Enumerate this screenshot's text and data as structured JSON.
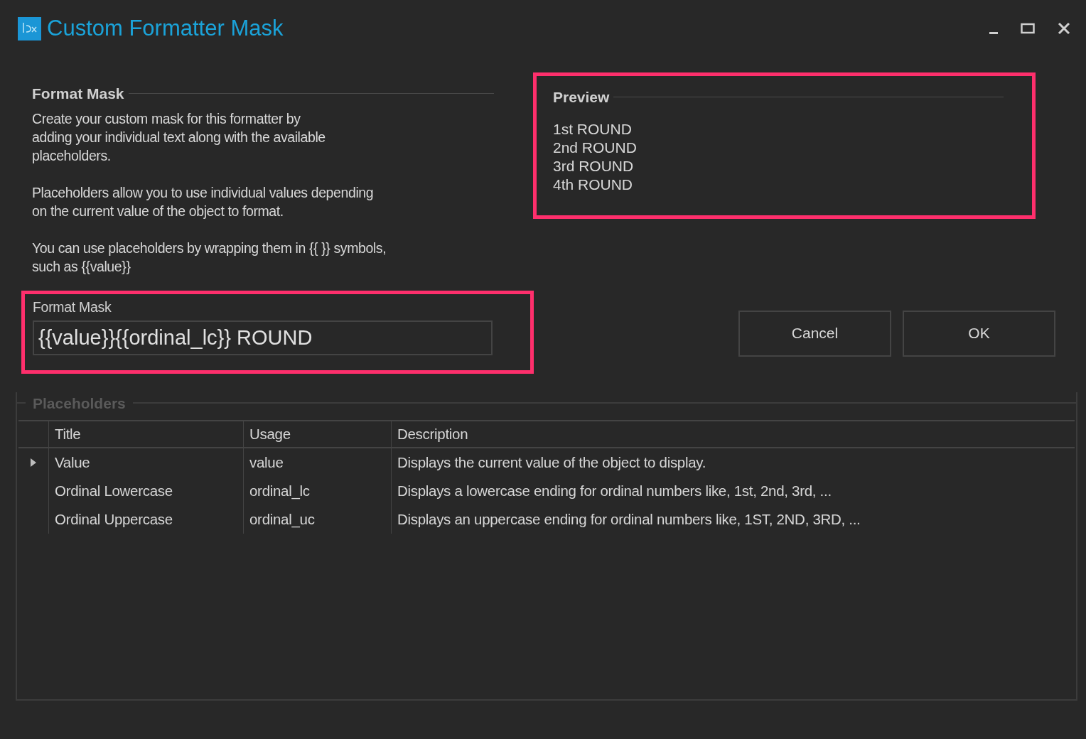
{
  "window": {
    "title": "Custom Formatter Mask"
  },
  "format_mask_section": {
    "heading": "Format Mask",
    "paragraphs": [
      [
        "Create your custom mask for this formatter by",
        "adding your individual text along with the available",
        "placeholders."
      ],
      [
        "Placeholders allow you to use individual values depending",
        "on the current value of the object to format."
      ],
      [
        "You can use placeholders by wrapping them in {{ }} symbols,",
        "such as {{value}}"
      ]
    ]
  },
  "preview": {
    "heading": "Preview",
    "lines": [
      "1st ROUND",
      "2nd ROUND",
      "3rd ROUND",
      "4th ROUND"
    ]
  },
  "format_mask_field": {
    "label": "Format Mask",
    "value": "{{value}}{{ordinal_lc}} ROUND"
  },
  "buttons": [
    "Cancel",
    "OK"
  ],
  "placeholders": {
    "heading": "Placeholders",
    "columns": [
      "Title",
      "Usage",
      "Description"
    ],
    "rows": [
      {
        "selected": true,
        "cells": [
          "Value",
          "value",
          "Displays the current value of the object to display."
        ]
      },
      {
        "selected": false,
        "cells": [
          "Ordinal Lowercase",
          "ordinal_lc",
          "Displays a lowercase ending for ordinal numbers like, 1st, 2nd, 3rd, ..."
        ]
      },
      {
        "selected": false,
        "cells": [
          "Ordinal Uppercase",
          "ordinal_uc",
          "Displays an uppercase ending for ordinal numbers like, 1ST, 2ND, 3RD, ..."
        ]
      }
    ]
  }
}
